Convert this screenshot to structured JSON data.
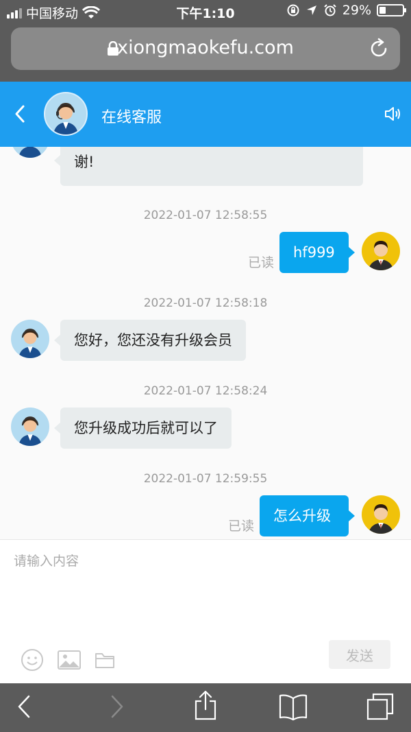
{
  "status": {
    "carrier": "中国移动",
    "time": "下午1:10",
    "battery": "29%",
    "battery_level": 0.29
  },
  "browser": {
    "url": "xiongmaokefu.com"
  },
  "header": {
    "title": "在线客服"
  },
  "messages": {
    "partial": {
      "text": "谢!"
    },
    "ts1": "2022-01-07 12:58:55",
    "m1": {
      "text": "hf999",
      "status": "已读"
    },
    "ts2": "2022-01-07 12:58:18",
    "m2": {
      "text": "您好，您还没有升级会员"
    },
    "ts3": "2022-01-07 12:58:24",
    "m3": {
      "text": "您升级成功后就可以了"
    },
    "ts4": "2022-01-07 12:59:55",
    "m4": {
      "text": "怎么升级",
      "status": "已读"
    }
  },
  "input": {
    "placeholder": "请输入内容",
    "send_label": "发送"
  },
  "icons": {
    "status": [
      "signal-icon",
      "wifi-icon",
      "orientation-lock-icon",
      "location-icon",
      "alarm-icon",
      "battery-icon"
    ],
    "browser": [
      "lock-icon",
      "reload-icon"
    ],
    "header": [
      "back-icon",
      "speaker-icon"
    ],
    "input": [
      "emoji-icon",
      "image-icon",
      "folder-icon"
    ],
    "toolbar": [
      "back-icon",
      "forward-icon",
      "share-icon",
      "bookmarks-icon",
      "tabs-icon"
    ]
  },
  "colors": {
    "header": "#1e9ef0",
    "bubble_user": "#0aa6ee",
    "bubble_cs": "#e8eced"
  }
}
